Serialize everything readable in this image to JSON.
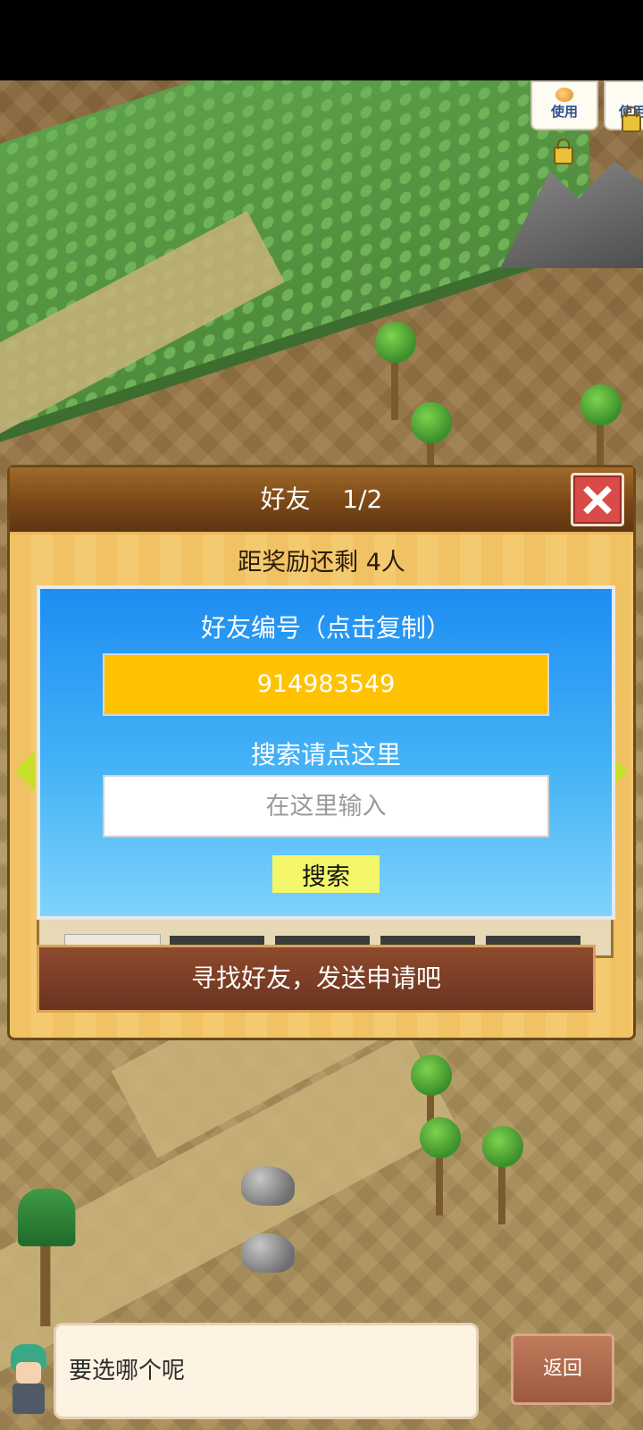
{
  "badges": {
    "use_label_1": "使用",
    "use_label_2": "使用"
  },
  "dialog": {
    "title": "好友",
    "page": "1/2",
    "reward_text": "距奖励还剩 4人",
    "popup": {
      "title": "好友编号（点击复制）",
      "friend_id": "914983549",
      "search_hint": "搜索请点这里",
      "search_placeholder": "在这里输入",
      "search_button": "搜索"
    },
    "find_friends_label": "寻找好友，发送申请吧"
  },
  "bottom": {
    "speech_text": "要选哪个呢",
    "back_label": "返回"
  },
  "colors": {
    "popup_gradient_top": "#1d8df2",
    "id_box": "#ffc200",
    "search_button": "#f4f66a",
    "close_button": "#d94b48"
  },
  "icons": [
    "close-icon",
    "lock-icon",
    "arrow-left-icon",
    "arrow-right-icon",
    "fruit-icon"
  ]
}
